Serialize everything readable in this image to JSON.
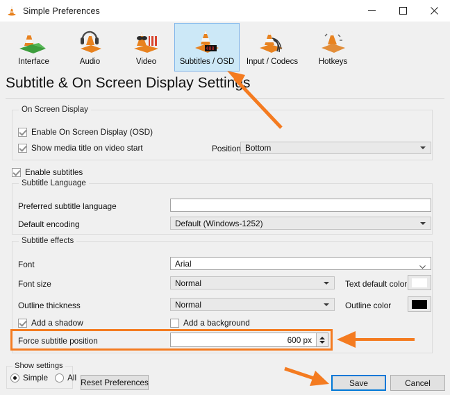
{
  "window": {
    "title": "Simple Preferences",
    "icon": "vlc-cone-icon",
    "controls": {
      "minimize": "minimize-icon",
      "maximize": "maximize-icon",
      "close": "close-icon"
    }
  },
  "toolbar": {
    "items": [
      {
        "label": "Interface",
        "icon": "vlc-interface-icon",
        "selected": false
      },
      {
        "label": "Audio",
        "icon": "vlc-audio-icon",
        "selected": false
      },
      {
        "label": "Video",
        "icon": "vlc-video-icon",
        "selected": false
      },
      {
        "label": "Subtitles / OSD",
        "icon": "vlc-subtitles-osd-icon",
        "selected": true
      },
      {
        "label": "Input / Codecs",
        "icon": "vlc-input-codecs-icon",
        "selected": false
      },
      {
        "label": "Hotkeys",
        "icon": "vlc-hotkeys-icon",
        "selected": false
      }
    ]
  },
  "page": {
    "heading": "Subtitle & On Screen Display Settings"
  },
  "osd": {
    "group_title": "On Screen Display",
    "enable_osd": {
      "label": "Enable On Screen Display (OSD)",
      "checked": true
    },
    "show_media_title": {
      "label": "Show media title on video start",
      "checked": true
    },
    "position_label": "Position",
    "position_value": "Bottom"
  },
  "enable_subtitles": {
    "label": "Enable subtitles",
    "checked": true
  },
  "subtitle_language": {
    "group_title": "Subtitle Language",
    "preferred_label": "Preferred subtitle language",
    "preferred_value": "",
    "encoding_label": "Default encoding",
    "encoding_value": "Default (Windows-1252)"
  },
  "subtitle_effects": {
    "group_title": "Subtitle effects",
    "font_label": "Font",
    "font_value": "Arial",
    "font_size_label": "Font size",
    "font_size_value": "Normal",
    "text_color_label": "Text default color",
    "text_color_value": "#ffffff",
    "outline_thickness_label": "Outline thickness",
    "outline_thickness_value": "Normal",
    "outline_color_label": "Outline color",
    "outline_color_value": "#000000",
    "add_shadow": {
      "label": "Add a shadow",
      "checked": true
    },
    "add_background": {
      "label": "Add a background",
      "checked": false
    },
    "force_position_label": "Force subtitle position",
    "force_position_value": "600 px"
  },
  "footer": {
    "show_settings_label": "Show settings",
    "simple_label": "Simple",
    "all_label": "All",
    "simple_selected": true,
    "reset_label": "Reset Preferences",
    "save_label": "Save",
    "cancel_label": "Cancel"
  },
  "annotations": {
    "accent_color": "#f47b20",
    "highlight_target": "Force subtitle position",
    "arrow_to_tab": "Subtitles / OSD",
    "arrow_to_save": "Save"
  }
}
